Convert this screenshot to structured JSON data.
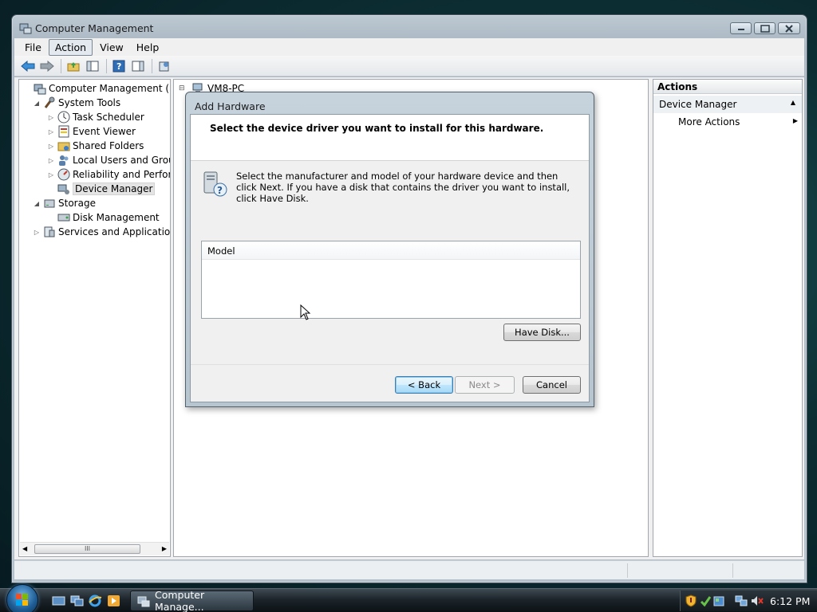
{
  "window": {
    "title": "Computer Management",
    "controls": {
      "minimize": "minimize",
      "maximize": "maximize",
      "close": "close"
    }
  },
  "menu": [
    "File",
    "Action",
    "View",
    "Help"
  ],
  "active_menu": "Action",
  "toolbar_icons": [
    "back-arrow-icon",
    "forward-arrow-icon",
    "up-folder-icon",
    "show-hide-tree-icon",
    "help-icon",
    "show-hide-action-pane-icon",
    "properties-icon"
  ],
  "tree": {
    "items": [
      {
        "label": "Computer Management (Local",
        "icon": "computer-management-icon",
        "level": 0,
        "expander": ""
      },
      {
        "label": "System Tools",
        "icon": "system-tools-icon",
        "level": 1,
        "expander": "expanded"
      },
      {
        "label": "Task Scheduler",
        "icon": "clock-icon",
        "level": 2,
        "expander": "collapsed"
      },
      {
        "label": "Event Viewer",
        "icon": "event-viewer-icon",
        "level": 2,
        "expander": "collapsed"
      },
      {
        "label": "Shared Folders",
        "icon": "shared-folders-icon",
        "level": 2,
        "expander": "collapsed"
      },
      {
        "label": "Local Users and Groups",
        "icon": "users-icon",
        "level": 2,
        "expander": "collapsed"
      },
      {
        "label": "Reliability and Performa",
        "icon": "reliability-icon",
        "level": 2,
        "expander": "collapsed"
      },
      {
        "label": "Device Manager",
        "icon": "device-manager-icon",
        "level": 2,
        "expander": "",
        "selected": true
      },
      {
        "label": "Storage",
        "icon": "storage-icon",
        "level": 1,
        "expander": "expanded"
      },
      {
        "label": "Disk Management",
        "icon": "disk-management-icon",
        "level": 2,
        "expander": ""
      },
      {
        "label": "Services and Applications",
        "icon": "services-icon",
        "level": 1,
        "expander": "collapsed"
      }
    ],
    "scroll_thumb_label": "III"
  },
  "center": {
    "node_label": "VM8-PC"
  },
  "actions": {
    "header": "Actions",
    "section": "Device Manager",
    "more_actions": "More Actions"
  },
  "dialog": {
    "title": "Add Hardware",
    "heading": "Select the device driver you want to install for this hardware.",
    "instruction": "Select the manufacturer and model of your hardware device and then click Next. If you have a disk that contains the driver you want to install, click Have Disk.",
    "model_column": "Model",
    "have_disk": "Have Disk...",
    "back": "< Back",
    "next": "Next >",
    "cancel": "Cancel"
  },
  "taskbar": {
    "task_label": "Computer Manage...",
    "clock": "6:12 PM"
  },
  "colors": {
    "desktop": "#0c2e33",
    "default_button_border": "#3c7fb1",
    "selection": "#e4e4e4"
  }
}
